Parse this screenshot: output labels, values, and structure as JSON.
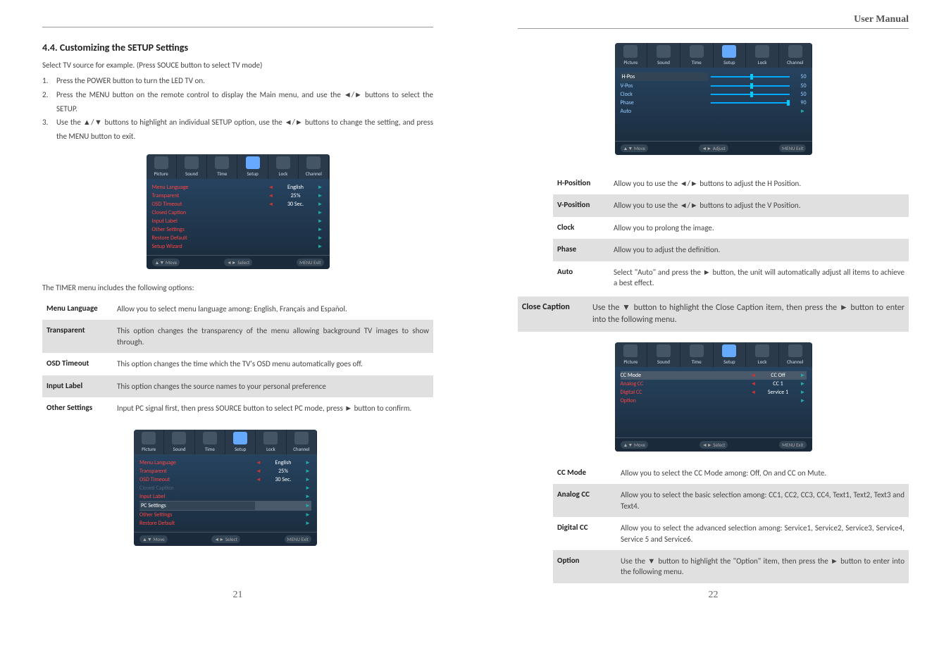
{
  "header": {
    "title": "User Manual"
  },
  "left": {
    "section_number": "4.4.",
    "section_title": "Customizing the SETUP Settings",
    "intro": "Select TV source for example. (Press SOUCE button to select TV mode)",
    "steps": [
      {
        "n": "1.",
        "t": "Press the POWER button to turn the LED TV on."
      },
      {
        "n": "2.",
        "t": "Press the MENU button on the remote control to display the Main menu, and use the ◄/► buttons to select the SETUP."
      },
      {
        "n": "3.",
        "t": "Use the ▲/▼ buttons to highlight an individual SETUP option, use the ◄/► buttons to change the setting, and press the MENU button to exit."
      }
    ],
    "menu": {
      "tabs": [
        "Picture",
        "Sound",
        "Time",
        "Setup",
        "Lock",
        "Channel"
      ],
      "rows": [
        {
          "label": "Menu Language",
          "value": "English"
        },
        {
          "label": "Transparent",
          "value": "25%"
        },
        {
          "label": "OSD Timeout",
          "value": "30 Sec."
        },
        {
          "label": "Closed Caption",
          "value": ""
        },
        {
          "label": "Input Label",
          "value": ""
        },
        {
          "label": "Other Settings",
          "value": ""
        },
        {
          "label": "Restore Default",
          "value": ""
        },
        {
          "label": "Setup Wizard",
          "value": ""
        }
      ],
      "footer": {
        "move": "▲▼ Move",
        "select": "◄► Select",
        "exit": "MENU  Exit"
      }
    },
    "timer_intro": "The TIMER menu includes the following options:",
    "defs": [
      {
        "term": "Menu Language",
        "desc": "Allow you to select menu language among: English, Français and Español.",
        "shaded": false
      },
      {
        "term": "Transparent",
        "desc": "This option changes the transparency of the menu allowing background TV images to show through.",
        "shaded": true
      },
      {
        "term": "OSD Timeout",
        "desc": "This option changes the time which the TV's OSD menu automatically goes off.",
        "shaded": false
      },
      {
        "term": "Input Label",
        "desc": "This option changes the source names to your personal preference",
        "shaded": true
      },
      {
        "term": "Other Settings",
        "desc": "Input PC signal first, then press SOURCE button to select PC mode, press ► button to confirm.",
        "shaded": false
      }
    ],
    "pc_menu": {
      "rows": [
        {
          "label": "Menu Language",
          "value": "English",
          "dim": false
        },
        {
          "label": "Transparent",
          "value": "25%",
          "dim": false
        },
        {
          "label": "OSD Timeout",
          "value": "30 Sec.",
          "dim": false
        },
        {
          "label": "Closed Caption",
          "value": "",
          "dim": true
        },
        {
          "label": "Input Label",
          "value": "",
          "dim": false
        },
        {
          "label": "PC Settings",
          "value": "",
          "dim": false,
          "hl": true
        },
        {
          "label": "Other Settings",
          "value": "",
          "dim": false
        },
        {
          "label": "Restore Default",
          "value": "",
          "dim": false
        }
      ]
    },
    "page_num": "21"
  },
  "right": {
    "pos_menu": {
      "rows": [
        {
          "label": "H-Pos",
          "val": "50"
        },
        {
          "label": "V-Pos",
          "val": "50"
        },
        {
          "label": "Clock",
          "val": "50"
        },
        {
          "label": "Phase",
          "val": "90"
        },
        {
          "label": "Auto",
          "val": ""
        }
      ],
      "footer": {
        "move": "▲▼ Move",
        "adjust": "◄► Adjust",
        "exit": "MENU  Exit"
      }
    },
    "pos_defs": [
      {
        "term": "H-Position",
        "desc": "Allow you to use the ◄/► buttons to adjust the H Position.",
        "shaded": false
      },
      {
        "term": "V-Position",
        "desc": "Allow you to use the ◄/► buttons to adjust the V Position.",
        "shaded": true
      },
      {
        "term": "Clock",
        "desc": "Allow you to prolong the image.",
        "shaded": false
      },
      {
        "term": "Phase",
        "desc": "Allow you to adjust the definition.",
        "shaded": true
      },
      {
        "term": "Auto",
        "desc": "Select \"Auto\" and press the ► button, the unit will automatically adjust all items to achieve a best effect.",
        "shaded": false
      }
    ],
    "close_caption": {
      "term": "Close Caption",
      "desc": "Use the ▼ button to highlight the Close Caption item, then press the ► button to enter into the following menu."
    },
    "cc_menu": {
      "rows": [
        {
          "label": "CC Mode",
          "value": "CC Off",
          "hl": true
        },
        {
          "label": "Analog CC",
          "value": "CC 1"
        },
        {
          "label": "Digital CC",
          "value": "Service 1"
        },
        {
          "label": "Option",
          "value": ""
        }
      ]
    },
    "cc_defs": [
      {
        "term": "CC Mode",
        "desc": "Allow you to select the CC Mode among: Off, On and CC on Mute.",
        "shaded": false
      },
      {
        "term": "Analog CC",
        "desc": "Allow you to select the basic selection among: CC1, CC2, CC3, CC4, Text1, Text2, Text3 and Text4.",
        "shaded": true
      },
      {
        "term": "Digital CC",
        "desc": "Allow you to select the advanced selection among: Service1, Service2, Service3, Service4, Service 5 and Service6.",
        "shaded": false
      },
      {
        "term": "Option",
        "desc": "Use the ▼ button to highlight the \"Option\" item, then press the ► button to enter into the following menu.",
        "shaded": true
      }
    ],
    "page_num": "22"
  }
}
